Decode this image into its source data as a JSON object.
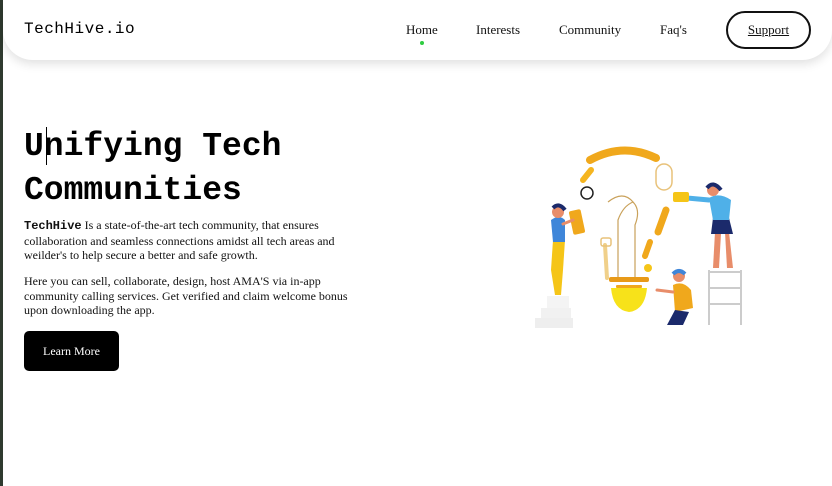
{
  "nav": {
    "brand": "TechHive.io",
    "links": [
      "Home",
      "Interests",
      "Community",
      "Faq's"
    ],
    "support_label": "Support"
  },
  "hero": {
    "title": "Unifying Tech Communities",
    "para1_brand": "TechHive",
    "para1_text": " Is a state-of-the-art tech community, that ensures collaboration and seamless connections amidst all tech areas and weilder's to help secure a better and safe growth.",
    "para2": "Here you can sell, collaborate, design, host AMA'S via in-app community calling services. Get verified and claim welcome bonus upon downloading the app.",
    "button_label": "Learn More"
  },
  "icons": {
    "illustration": "team-building-lightbulb-illustration",
    "active_indicator": "active-dot-icon"
  },
  "colors": {
    "active_dot": "#2ecc40",
    "button_bg": "#000000",
    "accent_yellow": "#f5b51f",
    "accent_blue": "#3f86d9"
  }
}
